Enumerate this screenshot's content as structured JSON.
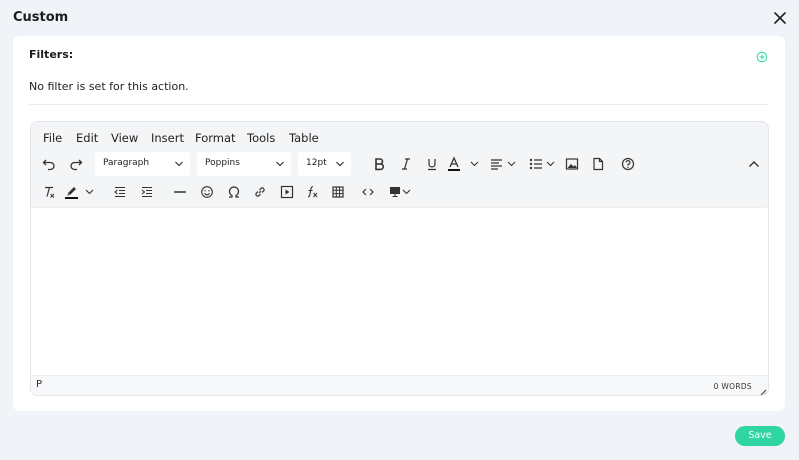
{
  "modal": {
    "title": "Custom"
  },
  "filters": {
    "label": "Filters:",
    "empty_text": "No filter is set for this action."
  },
  "editor": {
    "menu": [
      "File",
      "Edit",
      "View",
      "Insert",
      "Format",
      "Tools",
      "Table"
    ],
    "block_format": "Paragraph",
    "font_family": "Poppins",
    "font_size": "12pt",
    "path": "P",
    "word_count": "0 WORDS"
  },
  "footer": {
    "save_label": "Save"
  },
  "colors": {
    "accent": "#2fd6a3",
    "background": "#f0f3f7"
  }
}
